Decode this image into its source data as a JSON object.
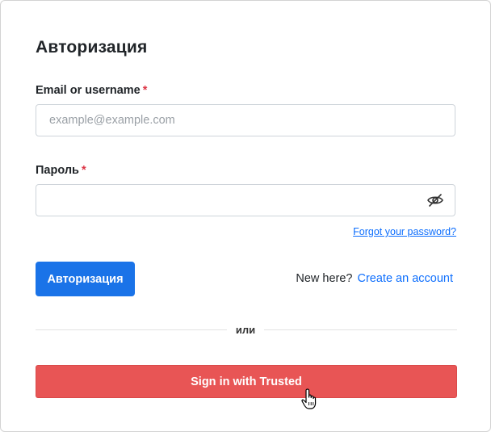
{
  "form": {
    "title": "Авторизация",
    "email_label": "Email or username",
    "email_placeholder": "example@example.com",
    "email_value": "",
    "required_mark": "*",
    "password_label": "Пароль",
    "password_value": "",
    "password_toggle_icon": "eye-slash-icon",
    "forgot_link": "Forgot your password?",
    "submit_label": "Авторизация",
    "new_here_text": "New here?",
    "create_account_link": "Create an account",
    "divider_text": "или",
    "trusted_button_label": "Sign in with Trusted"
  },
  "colors": {
    "primary": "#1a73e8",
    "link": "#0d6efd",
    "required": "#dc3545",
    "trusted": "#e85555"
  }
}
